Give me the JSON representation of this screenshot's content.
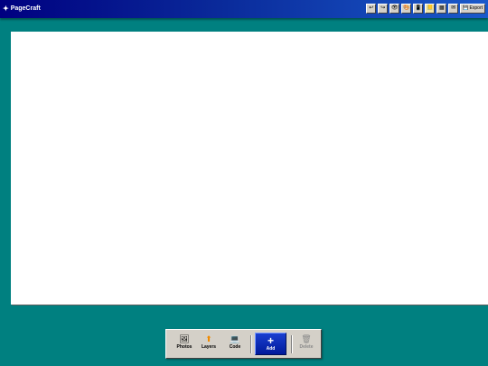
{
  "app": {
    "title": "PageCraft",
    "logo_icon": "✦"
  },
  "toolbar": {
    "buttons": [
      {
        "name": "undo",
        "glyph": "↩"
      },
      {
        "name": "redo",
        "glyph": "↪"
      },
      {
        "name": "preview",
        "glyph": "👁"
      },
      {
        "name": "theme",
        "glyph": "🎨"
      },
      {
        "name": "mobile",
        "glyph": "📱"
      },
      {
        "name": "notes",
        "glyph": "📒"
      },
      {
        "name": "grid",
        "glyph": "▦"
      },
      {
        "name": "mail",
        "glyph": "✉"
      }
    ],
    "export": {
      "icon": "💾",
      "label": "Export"
    }
  },
  "dock": {
    "photos": {
      "icon": "🖼",
      "label": "Photos"
    },
    "layers": {
      "icon": "⬆",
      "label": "Layers"
    },
    "code": {
      "icon": "💻",
      "label": "Code"
    },
    "add": {
      "icon": "+",
      "label": "Add"
    },
    "delete": {
      "icon": "🗑",
      "label": "Delete"
    }
  }
}
